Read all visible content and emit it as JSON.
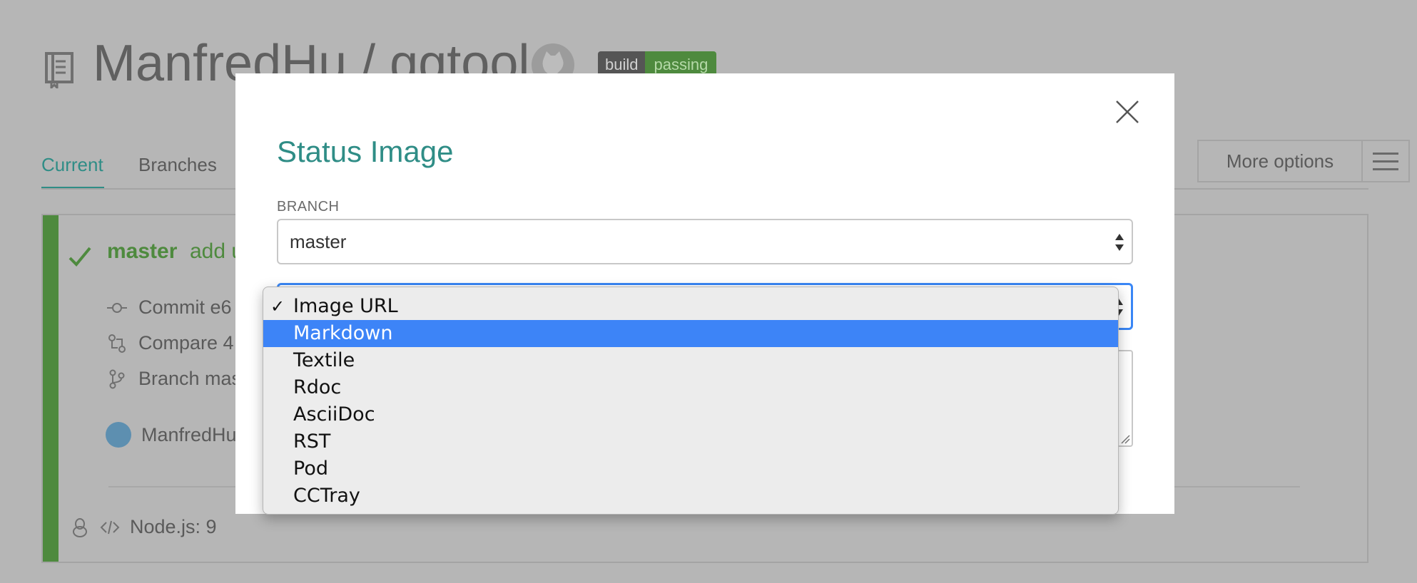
{
  "background": {
    "repo_title": "ManfredHu / ggtool",
    "badge": {
      "left": "build",
      "right": "passing"
    },
    "tabs": {
      "current": "Current",
      "branches": "Branches"
    },
    "more_options": "More options",
    "build": {
      "branch": "master",
      "message": "add u",
      "commit": "Commit e6",
      "compare": "Compare 4",
      "branch_line": "Branch mas",
      "author": "ManfredHu",
      "env": "Node.js: 9"
    }
  },
  "modal": {
    "title": "Status Image",
    "branch_label": "BRANCH",
    "branch_value": "master"
  },
  "format_dropdown": {
    "selected": "Image URL",
    "highlighted": "Markdown",
    "options": [
      "Image URL",
      "Markdown",
      "Textile",
      "Rdoc",
      "AsciiDoc",
      "RST",
      "Pod",
      "CCTray"
    ]
  },
  "colors": {
    "teal_accent": "#2f8d86",
    "passing_green": "#4e8a3e",
    "focus_blue": "#3a87f6",
    "highlight_blue": "#3d84f7"
  }
}
